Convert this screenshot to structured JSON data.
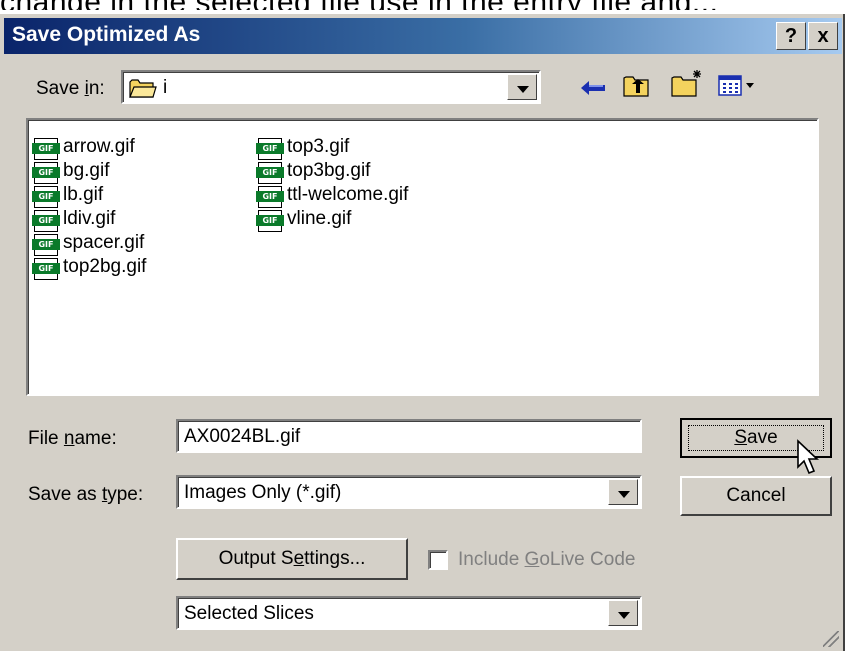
{
  "background_fragment": "change in the selected file use in the entry file and...",
  "window": {
    "title": "Save Optimized As",
    "help_button": "?",
    "close_button": "x"
  },
  "save_in": {
    "label_pre": "Save ",
    "label_u": "i",
    "label_post": "n:",
    "folder": "i",
    "folder_icon": "folder-icon"
  },
  "toolbar": {
    "back_icon": "back-arrow-icon",
    "up_icon": "up-folder-icon",
    "new_folder_icon": "new-folder-icon",
    "view_menu_icon": "view-menu-icon"
  },
  "files": [
    {
      "name": "arrow.gif",
      "badge": "GIF"
    },
    {
      "name": "bg.gif",
      "badge": "GIF"
    },
    {
      "name": "lb.gif",
      "badge": "GIF"
    },
    {
      "name": "ldiv.gif",
      "badge": "GIF"
    },
    {
      "name": "spacer.gif",
      "badge": "GIF"
    },
    {
      "name": "top2bg.gif",
      "badge": "GIF"
    },
    {
      "name": "top3.gif",
      "badge": "GIF"
    },
    {
      "name": "top3bg.gif",
      "badge": "GIF"
    },
    {
      "name": "ttl-welcome.gif",
      "badge": "GIF"
    },
    {
      "name": "vline.gif",
      "badge": "GIF"
    }
  ],
  "file_name": {
    "label_pre": "File ",
    "label_u": "n",
    "label_post": "ame:",
    "value": "AX0024BL.gif"
  },
  "save_as_type": {
    "label_pre": "Save as ",
    "label_u": "t",
    "label_post": "ype:",
    "value": "Images Only (*.gif)"
  },
  "buttons": {
    "save_u": "S",
    "save_rest": "ave",
    "cancel": "Cancel",
    "output_pre": "Output S",
    "output_u": "e",
    "output_post": "ttings..."
  },
  "include_golive": {
    "pre": "Include ",
    "u": "G",
    "post": "oLive Code",
    "checked": false
  },
  "slices": {
    "value": "Selected Slices"
  }
}
